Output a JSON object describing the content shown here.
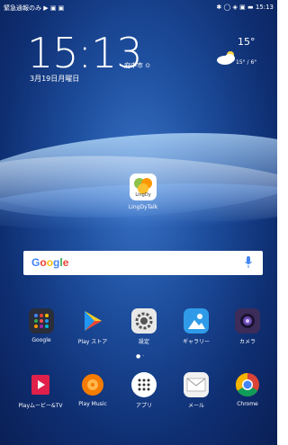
{
  "status": {
    "left_text": "緊急通報のみ ▶ ▣ ▣",
    "right_text": "✱ ◯ ◈ ▣ ▬ 15:13"
  },
  "clock": {
    "time": "15:13",
    "city": "府中市 ⊙",
    "date": "3月19日月曜日"
  },
  "weather": {
    "temp": "15°",
    "range": "15° / 6°",
    "icon": "partly-cloudy-icon"
  },
  "desktop_app": {
    "label": "LingDyTalk",
    "icon_text": "LingDy"
  },
  "search": {
    "logo": "Google",
    "mic_icon": "mic-icon"
  },
  "apps": [
    {
      "label": "Google",
      "icon": "folder-icon"
    },
    {
      "label": "Play ストア",
      "icon": "play-store-icon"
    },
    {
      "label": "設定",
      "icon": "settings-icon"
    },
    {
      "label": "ギャラリー",
      "icon": "gallery-icon"
    },
    {
      "label": "カメラ",
      "icon": "camera-icon"
    }
  ],
  "dock": [
    {
      "label": "Playムービー&TV",
      "icon": "play-movies-icon"
    },
    {
      "label": "Play Music",
      "icon": "play-music-icon"
    },
    {
      "label": "アプリ",
      "icon": "app-drawer-icon"
    },
    {
      "label": "メール",
      "icon": "mail-icon"
    },
    {
      "label": "Chrome",
      "icon": "chrome-icon"
    }
  ],
  "colors": {
    "play_movies": "#e0204a",
    "play_music": "#f57c00",
    "gallery": "#2f9be8",
    "camera": "#3b2c5a"
  }
}
